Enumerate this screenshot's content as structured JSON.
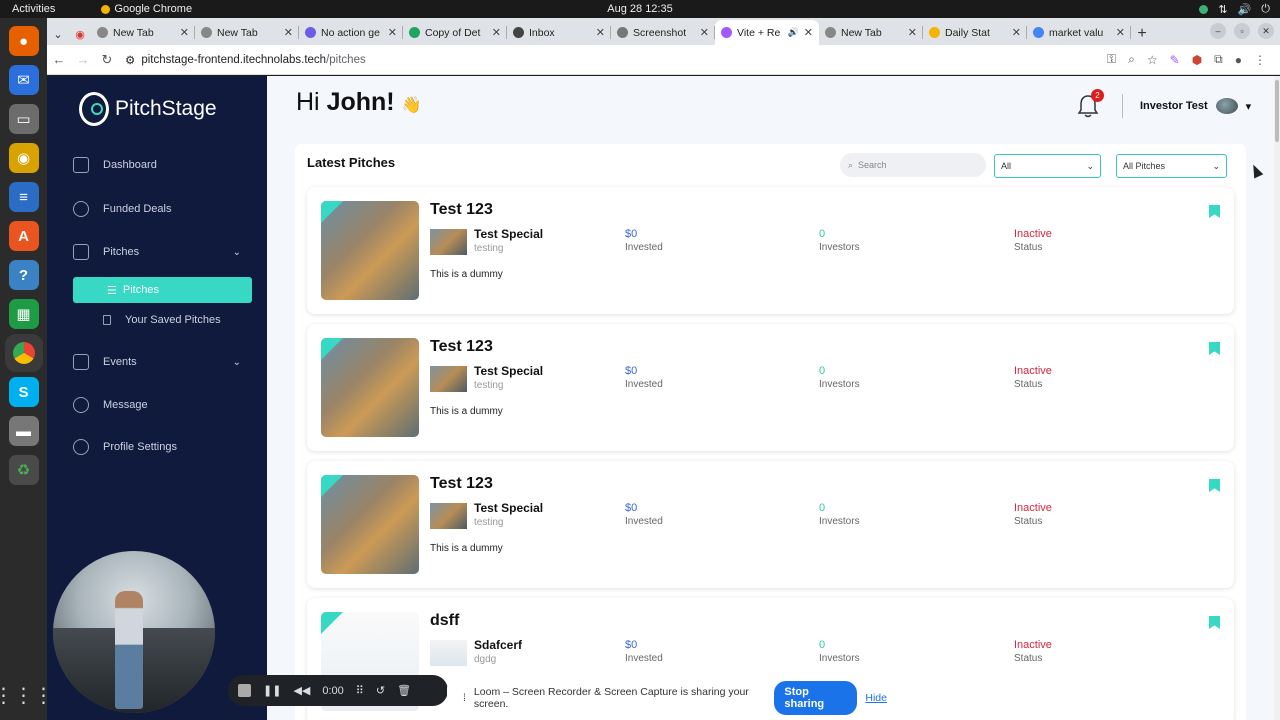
{
  "os": {
    "activities": "Activities",
    "app_name": "Google Chrome",
    "clock": "Aug 28  12:35"
  },
  "browser": {
    "tabs": [
      {
        "label": "New Tab",
        "color": "#888"
      },
      {
        "label": "New Tab",
        "color": "#888"
      },
      {
        "label": "No action ge",
        "color": "#6c5ce7"
      },
      {
        "label": "Copy of Det",
        "color": "#1fa463"
      },
      {
        "label": "Inbox",
        "color": "#444"
      },
      {
        "label": "Screenshot",
        "color": "#777"
      },
      {
        "label": "Vite + Re",
        "color": "#a259ff"
      },
      {
        "label": "New Tab",
        "color": "#888"
      },
      {
        "label": "Daily Stat",
        "color": "#f4b400"
      },
      {
        "label": "market valu",
        "color": "#4285f4"
      }
    ],
    "new_tab": "+",
    "url_host": "pitchstage-frontend.itechnolabs.tech",
    "url_path": "/pitches"
  },
  "sidebar": {
    "brand": "PitchStage",
    "items": [
      {
        "label": "Dashboard"
      },
      {
        "label": "Funded Deals"
      },
      {
        "label": "Pitches"
      },
      {
        "label": "Pitches"
      },
      {
        "label": "Your Saved Pitches"
      },
      {
        "label": "Events"
      },
      {
        "label": "Message"
      },
      {
        "label": "Profile Settings"
      }
    ]
  },
  "header": {
    "greeting": "Hi",
    "name": "John!",
    "notification_count": "2",
    "user_name": "Investor Test"
  },
  "panel": {
    "title": "Latest Pitches",
    "search_placeholder": "Search",
    "filter_1": "All",
    "filter_2": "All Pitches"
  },
  "pitches": [
    {
      "title": "Test 123",
      "company": "Test Special",
      "company_sub": "testing",
      "description": "This is a dummy",
      "invested": "$0",
      "invested_label": "Invested",
      "investors": "0",
      "investors_label": "Investors",
      "status": "Inactive",
      "status_label": "Status"
    },
    {
      "title": "Test 123",
      "company": "Test Special",
      "company_sub": "testing",
      "description": "This is a dummy",
      "invested": "$0",
      "invested_label": "Invested",
      "investors": "0",
      "investors_label": "Investors",
      "status": "Inactive",
      "status_label": "Status"
    },
    {
      "title": "Test 123",
      "company": "Test Special",
      "company_sub": "testing",
      "description": "This is a dummy",
      "invested": "$0",
      "invested_label": "Invested",
      "investors": "0",
      "investors_label": "Investors",
      "status": "Inactive",
      "status_label": "Status"
    },
    {
      "title": "dsff",
      "company": "Sdafcerf",
      "company_sub": "dgdg",
      "description": "",
      "invested": "$0",
      "invested_label": "Invested",
      "investors": "0",
      "investors_label": "Investors",
      "status": "Inactive",
      "status_label": "Status"
    }
  ],
  "recorder": {
    "time": "0:00",
    "share_text": "Loom – Screen Recorder & Screen Capture is sharing your screen.",
    "stop_label": "Stop sharing",
    "hide_label": "Hide"
  },
  "colors": {
    "accent": "#38d9c4",
    "sidebar_bg": "#0f1a3c",
    "invested": "#3a66d6",
    "investors": "#2fcaa6",
    "inactive": "#d7263d"
  }
}
